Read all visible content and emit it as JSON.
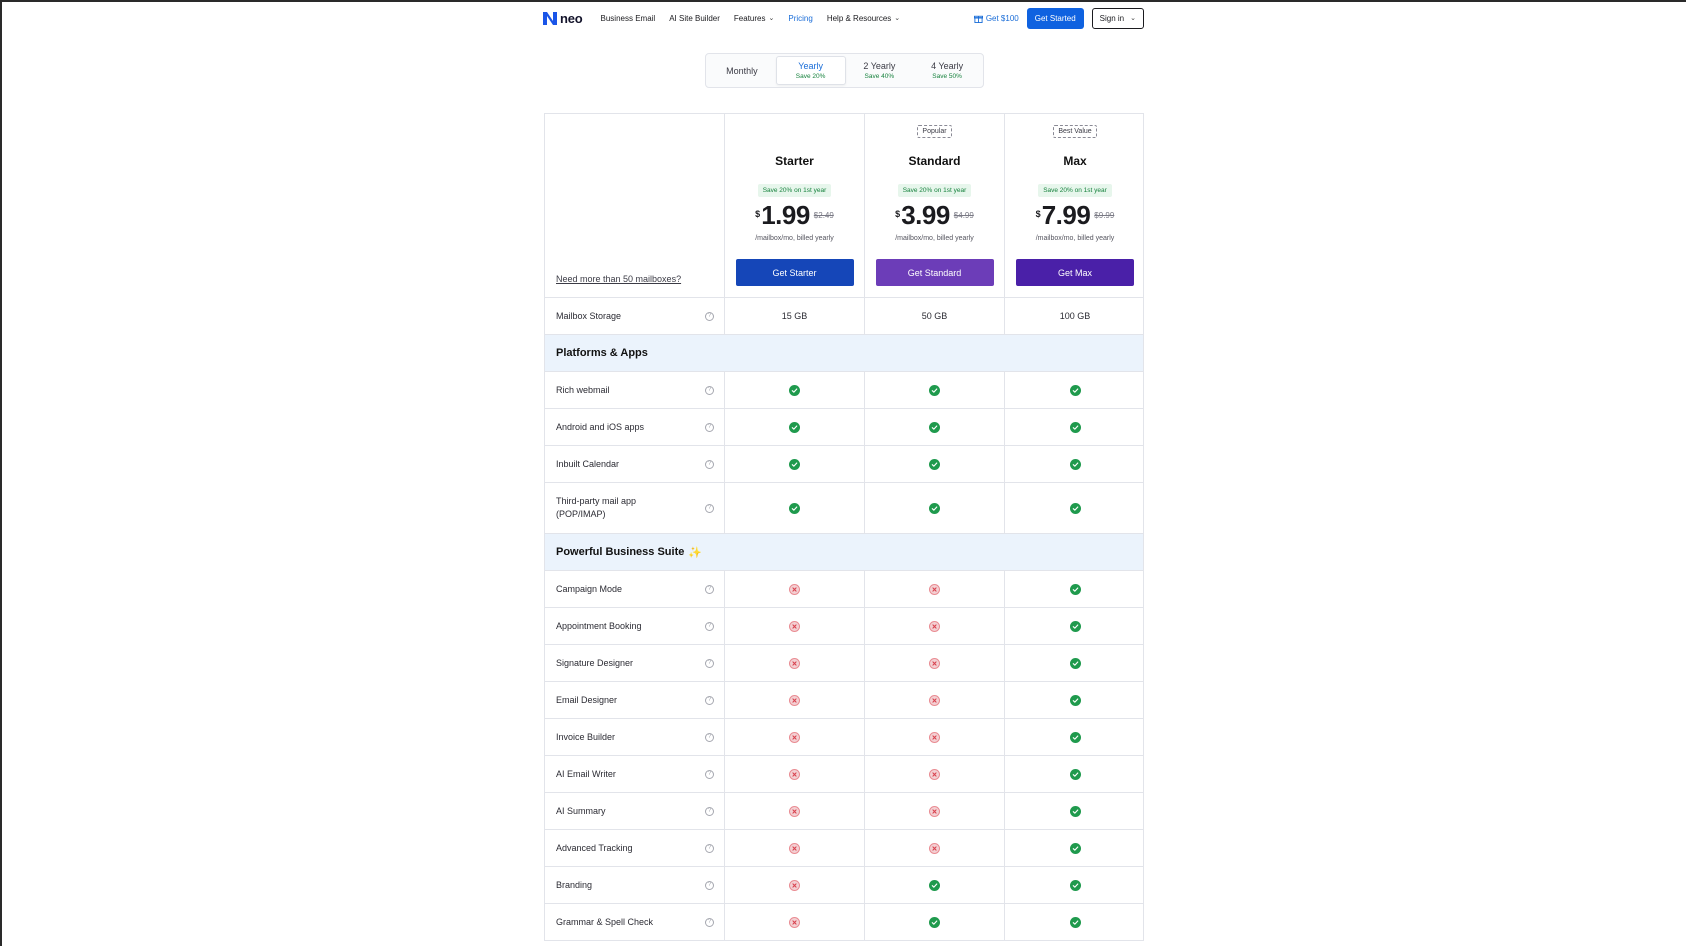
{
  "nav": {
    "logo_text": "neo",
    "links": [
      {
        "label": "Business Email",
        "dropdown": false,
        "active": false
      },
      {
        "label": "AI Site Builder",
        "dropdown": false,
        "active": false
      },
      {
        "label": "Features",
        "dropdown": true,
        "active": false
      },
      {
        "label": "Pricing",
        "dropdown": false,
        "active": true
      },
      {
        "label": "Help & Resources",
        "dropdown": true,
        "active": false
      }
    ],
    "referral_label": "Get $100",
    "get_started_label": "Get Started",
    "sign_in_label": "Sign in"
  },
  "billing": {
    "options": [
      {
        "label": "Monthly",
        "save": ""
      },
      {
        "label": "Yearly",
        "save": "Save 20%"
      },
      {
        "label": "2 Yearly",
        "save": "Save 40%"
      },
      {
        "label": "4 Yearly",
        "save": "Save 50%"
      }
    ],
    "selected": "Yearly"
  },
  "table": {
    "more_mailboxes_link": "Need more than 50 mailboxes?",
    "plans": [
      {
        "tag": "",
        "name": "Starter",
        "save_badge": "Save 20% on 1st year",
        "currency": "$",
        "price": "1.99",
        "old_price": "$2.49",
        "billed": "/mailbox/mo, billed yearly",
        "button": "Get Starter"
      },
      {
        "tag": "Popular",
        "name": "Standard",
        "save_badge": "Save 20% on 1st year",
        "currency": "$",
        "price": "3.99",
        "old_price": "$4.99",
        "billed": "/mailbox/mo, billed yearly",
        "button": "Get Standard"
      },
      {
        "tag": "Best Value",
        "name": "Max",
        "save_badge": "Save 20% on 1st year",
        "currency": "$",
        "price": "7.99",
        "old_price": "$9.99",
        "billed": "/mailbox/mo, billed yearly",
        "button": "Get Max"
      }
    ],
    "storage": {
      "label": "Mailbox Storage",
      "values": [
        "15 GB",
        "50 GB",
        "100 GB"
      ]
    },
    "sections": [
      {
        "title": "Platforms & Apps",
        "sparkle": false,
        "features": [
          {
            "label": "Rich webmail",
            "values": [
              "check",
              "check",
              "check"
            ]
          },
          {
            "label": "Android and iOS apps",
            "values": [
              "check",
              "check",
              "check"
            ]
          },
          {
            "label": "Inbuilt Calendar",
            "values": [
              "check",
              "check",
              "check"
            ]
          },
          {
            "label": "Third-party mail app (POP/IMAP)",
            "values": [
              "check",
              "check",
              "check"
            ]
          }
        ]
      },
      {
        "title": "Powerful Business Suite",
        "sparkle": true,
        "features": [
          {
            "label": "Campaign Mode",
            "values": [
              "cross",
              "cross",
              "check"
            ]
          },
          {
            "label": "Appointment Booking",
            "values": [
              "cross",
              "cross",
              "check"
            ]
          },
          {
            "label": "Signature Designer",
            "values": [
              "cross",
              "cross",
              "check"
            ]
          },
          {
            "label": "Email Designer",
            "values": [
              "cross",
              "cross",
              "check"
            ]
          },
          {
            "label": "Invoice Builder",
            "values": [
              "cross",
              "cross",
              "check"
            ]
          },
          {
            "label": "AI Email Writer",
            "values": [
              "cross",
              "cross",
              "check"
            ]
          },
          {
            "label": "AI Summary",
            "values": [
              "cross",
              "cross",
              "check"
            ]
          },
          {
            "label": "Advanced Tracking",
            "values": [
              "cross",
              "cross",
              "check"
            ]
          },
          {
            "label": "Branding",
            "values": [
              "cross",
              "check",
              "check"
            ]
          },
          {
            "label": "Grammar & Spell Check",
            "values": [
              "cross",
              "check",
              "check"
            ]
          }
        ]
      }
    ]
  },
  "colors": {
    "accent": "#0f62e0",
    "check": "#1f9a4d",
    "cross": "#e98b92",
    "section_bg": "#ebf3fc"
  }
}
